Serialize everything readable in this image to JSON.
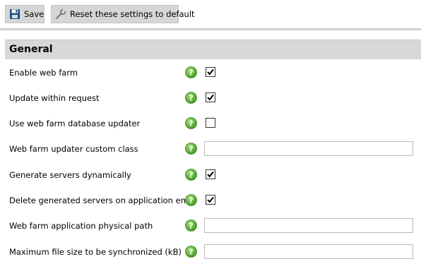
{
  "toolbar": {
    "save_label": "Save",
    "save_icon": "floppy-disk-icon",
    "reset_label": "Reset these settings to default",
    "reset_icon": "wrench-icon"
  },
  "section": {
    "title": "General"
  },
  "colors": {
    "help_icon_green": "#5fb336",
    "header_bg": "#d8d8d8",
    "button_bg": "#d6d6d6"
  },
  "settings": [
    {
      "label": "Enable web farm",
      "type": "checkbox",
      "checked": true
    },
    {
      "label": "Update within request",
      "type": "checkbox",
      "checked": true
    },
    {
      "label": "Use web farm database updater",
      "type": "checkbox",
      "checked": false
    },
    {
      "label": "Web farm updater custom class",
      "type": "text",
      "value": ""
    },
    {
      "label": "Generate servers dynamically",
      "type": "checkbox",
      "checked": true
    },
    {
      "label": "Delete generated servers on application end",
      "type": "checkbox",
      "checked": true
    },
    {
      "label": "Web farm application physical path",
      "type": "text",
      "value": ""
    },
    {
      "label": "Maximum file size to be synchronized (kB)",
      "type": "text",
      "value": ""
    }
  ]
}
